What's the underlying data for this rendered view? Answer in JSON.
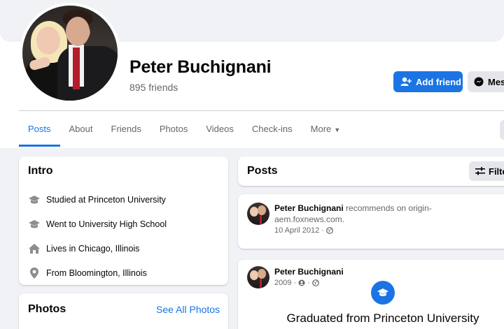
{
  "profile": {
    "name": "Peter Buchignani",
    "friends": "895 friends"
  },
  "actions": {
    "add_friend": "Add friend",
    "message": "Mes"
  },
  "tabs": [
    {
      "label": "Posts",
      "active": true
    },
    {
      "label": "About"
    },
    {
      "label": "Friends"
    },
    {
      "label": "Photos"
    },
    {
      "label": "Videos"
    },
    {
      "label": "Check-ins"
    },
    {
      "label": "More"
    }
  ],
  "intro": {
    "title": "Intro",
    "items": [
      {
        "icon": "graduation-cap-icon",
        "prefix": "Studied at ",
        "value": "Princeton University"
      },
      {
        "icon": "graduation-cap-icon",
        "prefix": "Went to University High School",
        "value": ""
      },
      {
        "icon": "home-icon",
        "prefix": "Lives in ",
        "value": "Chicago, Illinois"
      },
      {
        "icon": "location-pin-icon",
        "prefix": "From ",
        "value": "Bloomington, Illinois"
      }
    ]
  },
  "photos": {
    "title": "Photos",
    "see_all": "See All Photos"
  },
  "posts": {
    "title": "Posts",
    "filter_label": "Filte",
    "items": [
      {
        "author": "Peter Buchignani",
        "text_line1": " recommends on origin-",
        "text_line2": "aem.foxnews.com.",
        "meta": "10 April 2012 ·"
      },
      {
        "author": "Peter Buchignani",
        "meta": "2009 ·",
        "event": "Graduated from Princeton University"
      }
    ]
  },
  "colors": {
    "accent": "#1b74e4",
    "background": "#f0f2f5",
    "secondary_text": "#65676b"
  }
}
